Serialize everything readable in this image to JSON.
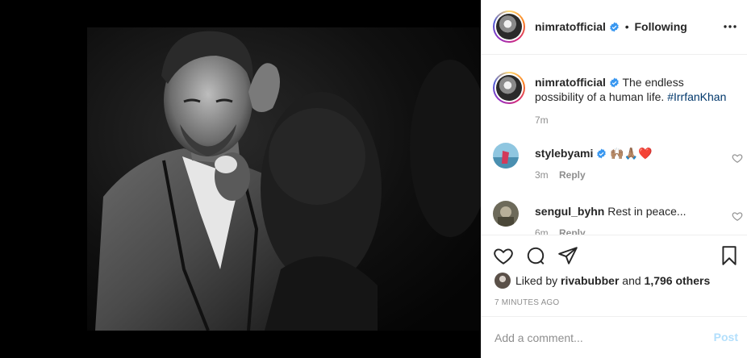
{
  "post": {
    "author": "nimratofficial",
    "follow_status": "Following",
    "caption_text": "The endless possibility of a human life.",
    "caption_hashtag": "#IrrfanKhan",
    "caption_time": "7m"
  },
  "comments": [
    {
      "user": "stylebyami",
      "text": "🙌🏽🙏🏽❤️",
      "time": "3m",
      "reply_label": "Reply",
      "verified": true
    },
    {
      "user": "sengul_byhn",
      "text": "Rest in peace...",
      "time": "6m",
      "reply_label": "Reply",
      "verified": false
    }
  ],
  "likes": {
    "prefix": "Liked by",
    "user": "rivabubber",
    "connector": "and",
    "others": "1,796 others"
  },
  "timestamp": "7 MINUTES AGO",
  "comment_box": {
    "placeholder": "Add a comment...",
    "post_label": "Post"
  },
  "colors": {
    "verified": "#3897f0",
    "hashtag": "#00376b",
    "post_disabled": "#b2dffc",
    "muted": "#8e8e8e"
  }
}
